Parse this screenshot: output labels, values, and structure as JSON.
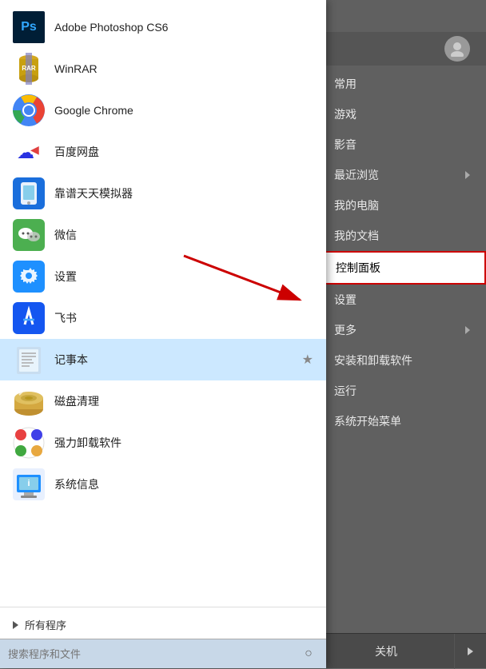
{
  "apps": [
    {
      "id": "photoshop",
      "label": "Adobe Photoshop CS6",
      "icon_type": "ps"
    },
    {
      "id": "winrar",
      "label": "WinRAR",
      "icon_type": "winrar"
    },
    {
      "id": "chrome",
      "label": "Google Chrome",
      "icon_type": "chrome"
    },
    {
      "id": "baidu",
      "label": "百度网盘",
      "icon_type": "baidu"
    },
    {
      "id": "phone",
      "label": "靠谱天天模拟器",
      "icon_type": "phone"
    },
    {
      "id": "wechat",
      "label": "微信",
      "icon_type": "wechat"
    },
    {
      "id": "settings",
      "label": "设置",
      "icon_type": "settings"
    },
    {
      "id": "feishu",
      "label": "飞书",
      "icon_type": "feishu"
    },
    {
      "id": "notepad",
      "label": "记事本",
      "icon_type": "notepad",
      "selected": true,
      "starred": true
    },
    {
      "id": "diskcleaner",
      "label": "磁盘清理",
      "icon_type": "disk"
    },
    {
      "id": "uninstall",
      "label": "强力卸载软件",
      "icon_type": "uninstall"
    },
    {
      "id": "sysinfo",
      "label": "系统信息",
      "icon_type": "sysinfo"
    }
  ],
  "all_programs_label": "所有程序",
  "search_placeholder": "搜索程序和文件",
  "right_menu": [
    {
      "id": "changyong",
      "label": "常用",
      "has_arrow": false
    },
    {
      "id": "youxi",
      "label": "游戏",
      "has_arrow": false
    },
    {
      "id": "yingyin",
      "label": "影音",
      "has_arrow": false
    },
    {
      "id": "zuijin",
      "label": "最近浏览",
      "has_arrow": true
    },
    {
      "id": "mypc",
      "label": "我的电脑",
      "has_arrow": false
    },
    {
      "id": "mydoc",
      "label": "我的文档",
      "has_arrow": false
    },
    {
      "id": "controlpanel",
      "label": "控制面板",
      "has_arrow": false,
      "highlighted": true
    },
    {
      "id": "shezhi",
      "label": "设置",
      "has_arrow": false
    },
    {
      "id": "more",
      "label": "更多",
      "has_arrow": true
    },
    {
      "id": "install",
      "label": "安装和卸载软件",
      "has_arrow": false
    },
    {
      "id": "run",
      "label": "运行",
      "has_arrow": false
    },
    {
      "id": "startmenu",
      "label": "系统开始菜单",
      "has_arrow": false
    }
  ],
  "shutdown_label": "关机",
  "icons": {
    "search": "○",
    "star": "★",
    "arrow_right": "▶"
  }
}
